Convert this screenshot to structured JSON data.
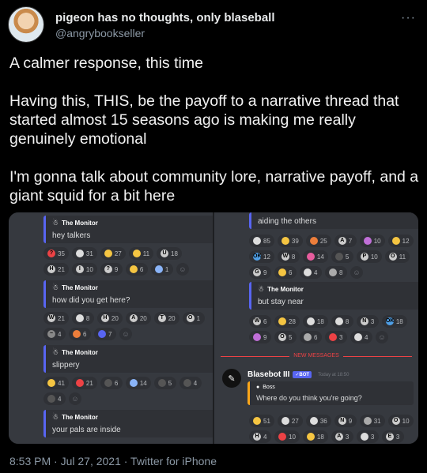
{
  "tweet": {
    "display_name": "pigeon has no thoughts, only blaseball",
    "handle": "@angrybookseller",
    "paragraphs": [
      "A calmer response, this time",
      "Having this, THIS, be the payoff to a narrative thread that started almost 15 seasons ago is making me really genuinely emotional",
      "I'm gonna talk about community lore, narrative payoff, and a giant squid for a bit here"
    ],
    "timestamp": "8:53 PM · Jul 27, 2021 · Twitter for iPhone"
  },
  "left_panel": {
    "messages": [
      {
        "author": "The Monitor",
        "text": "hey talkers"
      },
      {
        "author": "The Monitor",
        "text": "how did you get here?"
      },
      {
        "author": "The Monitor",
        "text": "slippery"
      },
      {
        "author": "The Monitor",
        "text": "your pals are inside"
      }
    ],
    "reaction_rows": [
      [
        {
          "e": "?",
          "c": "#ed4245",
          "n": "35"
        },
        {
          "e": "",
          "c": "#ddd",
          "n": "31"
        },
        {
          "e": "",
          "c": "#f5c542",
          "n": "27"
        },
        {
          "e": "",
          "c": "#f5c542",
          "n": "11"
        },
        {
          "e": "U",
          "c": "#ccc",
          "n": "18"
        },
        {
          "e": "H",
          "c": "#ccc",
          "n": "21"
        },
        {
          "e": "I",
          "c": "#ccc",
          "n": "10"
        },
        {
          "e": "?",
          "c": "#ccc",
          "n": "9"
        },
        {
          "e": "",
          "c": "#f5c542",
          "n": "6"
        },
        {
          "e": "",
          "c": "#8ab4f8",
          "n": "1"
        }
      ],
      [
        {
          "e": "W",
          "c": "#ccc",
          "n": "21"
        },
        {
          "e": "",
          "c": "#ddd",
          "n": "8"
        },
        {
          "e": "H",
          "c": "#ccc",
          "n": "20"
        },
        {
          "e": "A",
          "c": "#ccc",
          "n": "20"
        },
        {
          "e": "T",
          "c": "#ccc",
          "n": "20"
        },
        {
          "e": "O",
          "c": "#ccc",
          "n": "1"
        },
        {
          "e": "~",
          "c": "#888",
          "n": "4"
        },
        {
          "e": "",
          "c": "#ed7e3b",
          "n": "6"
        },
        {
          "e": "",
          "c": "#5865f2",
          "n": "7"
        }
      ],
      [
        {
          "e": "",
          "c": "#f5c542",
          "n": "41"
        },
        {
          "e": "",
          "c": "#ed4245",
          "n": "21"
        },
        {
          "e": "",
          "c": "#555",
          "n": "6"
        },
        {
          "e": "",
          "c": "#8ab4f8",
          "n": "14"
        },
        {
          "e": "",
          "c": "#555",
          "n": "5"
        },
        {
          "e": "",
          "c": "#555",
          "n": "4"
        },
        {
          "e": "",
          "c": "#555",
          "n": "4"
        }
      ]
    ]
  },
  "right_panel": {
    "top_message": "aiding the others",
    "second_message": {
      "author": "The Monitor",
      "text": "but stay near"
    },
    "reaction_rows": [
      [
        {
          "e": "",
          "c": "#ddd",
          "n": "85"
        },
        {
          "e": "",
          "c": "#f5c542",
          "n": "39"
        },
        {
          "e": "",
          "c": "#ed7e3b",
          "n": "25"
        },
        {
          "e": "A",
          "c": "#ccc",
          "n": "7"
        },
        {
          "e": "",
          "c": "#c06fd8",
          "n": "10"
        },
        {
          "e": "",
          "c": "#f5c542",
          "n": "12"
        },
        {
          "e": "OK",
          "c": "#4f9fe6",
          "n": "12"
        },
        {
          "e": "W",
          "c": "#ccc",
          "n": "8"
        },
        {
          "e": "",
          "c": "#e85d9e",
          "n": "14"
        },
        {
          "e": "",
          "c": "#555",
          "n": "5"
        },
        {
          "e": "P",
          "c": "#ccc",
          "n": "10"
        },
        {
          "e": "O",
          "c": "#ccc",
          "n": "11"
        },
        {
          "e": "G",
          "c": "#ccc",
          "n": "9"
        },
        {
          "e": "",
          "c": "#f5c542",
          "n": "6"
        },
        {
          "e": "",
          "c": "#ddd",
          "n": "4"
        },
        {
          "e": "",
          "c": "#aaa",
          "n": "8"
        }
      ],
      [
        {
          "e": "W",
          "c": "#ccc",
          "n": "6"
        },
        {
          "e": "",
          "c": "#f5c542",
          "n": "28"
        },
        {
          "e": "",
          "c": "#ddd",
          "n": "18"
        },
        {
          "e": "",
          "c": "#ddd",
          "n": "8"
        },
        {
          "e": "N",
          "c": "#ccc",
          "n": "3"
        },
        {
          "e": "OK",
          "c": "#4f9fe6",
          "n": "18"
        },
        {
          "e": "",
          "c": "#c06fd8",
          "n": "9"
        },
        {
          "e": "O",
          "c": "#ccc",
          "n": "5"
        },
        {
          "e": "",
          "c": "#aaa",
          "n": "6"
        },
        {
          "e": "",
          "c": "#ed4245",
          "n": "3"
        },
        {
          "e": "",
          "c": "#ddd",
          "n": "4"
        }
      ],
      [
        {
          "e": "",
          "c": "#f5c542",
          "n": "51"
        },
        {
          "e": "",
          "c": "#ddd",
          "n": "27"
        },
        {
          "e": "",
          "c": "#ddd",
          "n": "36"
        },
        {
          "e": "N",
          "c": "#ccc",
          "n": "9"
        },
        {
          "e": "",
          "c": "#aaa",
          "n": "31"
        },
        {
          "e": "O",
          "c": "#ccc",
          "n": "10"
        },
        {
          "e": "H",
          "c": "#ccc",
          "n": "4"
        },
        {
          "e": "",
          "c": "#ed4245",
          "n": "10"
        },
        {
          "e": "",
          "c": "#f5c542",
          "n": "18"
        },
        {
          "e": "A",
          "c": "#ccc",
          "n": "3"
        },
        {
          "e": "",
          "c": "#ddd",
          "n": "3"
        },
        {
          "e": "E",
          "c": "#ccc",
          "n": "3"
        }
      ]
    ],
    "new_messages_label": "NEW MESSAGES",
    "bot": {
      "name": "Blasebot III",
      "badge": "✓BOT",
      "time": "Today at 18:50"
    },
    "reply": {
      "author": "Boss",
      "text": "Where do you think you're going?"
    }
  }
}
